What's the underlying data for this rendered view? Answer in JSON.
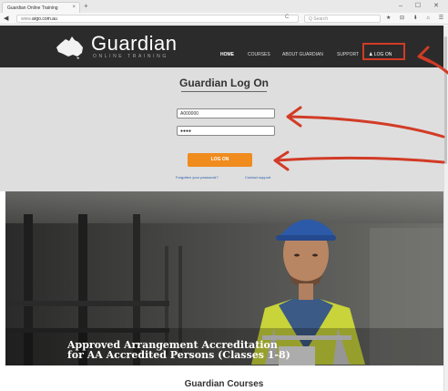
{
  "browser": {
    "tab_title": "Guardian Online Training",
    "tab_close": "×",
    "new_tab": "+",
    "window_controls": "– ☐ ✕",
    "back_icon": "back-arrow-icon",
    "url_prefix": "www.",
    "url_domain": "argo.com.au",
    "reload": "C",
    "search_placeholder": "Q  Search",
    "toolbar_icons": "★ ⊟ ⬇ ⌂ ☰"
  },
  "header": {
    "brand": "Guardian",
    "tagline": "ONLINE TRAINING",
    "nav": {
      "home": "HOME",
      "courses": "COURSES",
      "about": "ABOUT GUARDIAN",
      "support": "SUPPORT",
      "login": "LOG ON"
    }
  },
  "login": {
    "title": "Guardian Log On",
    "username_value": "A000000",
    "password_value": "●●●●",
    "button_label": "LOG ON",
    "forgot_link": "Forgotten your password?",
    "contact_link": "Contact support"
  },
  "hero": {
    "line1": "Approved Arrangement Accreditation",
    "line2": "for AA Accredited Persons (Classes 1-8)"
  },
  "courses": {
    "heading": "Guardian Courses"
  },
  "colors": {
    "header_bg": "#2b2b2b",
    "accent_orange": "#f08b1d",
    "annotation_red": "#d23b26",
    "panel_bg": "#dedede"
  }
}
